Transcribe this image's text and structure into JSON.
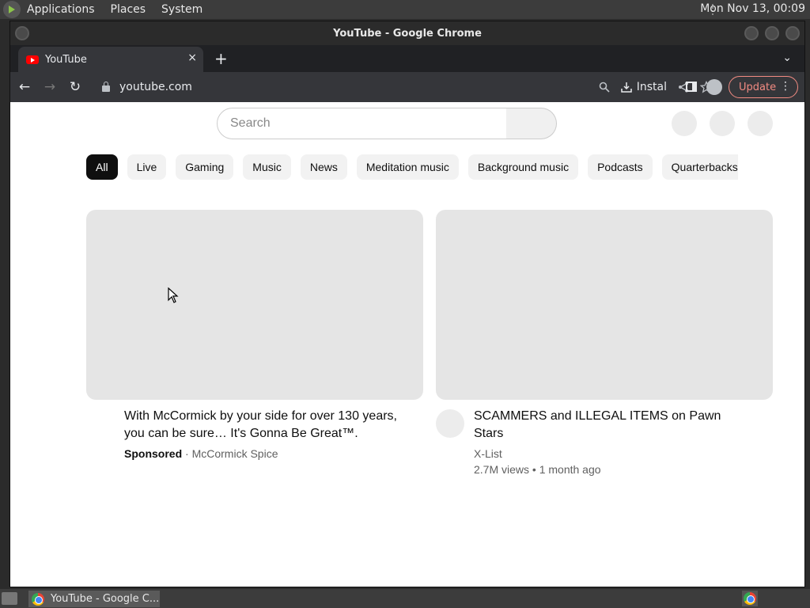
{
  "desktop": {
    "menus": [
      "Applications",
      "Places",
      "System"
    ],
    "clock": "Mon Nov 13, 00:09"
  },
  "window": {
    "title": "YouTube - Google Chrome"
  },
  "tab": {
    "title": "YouTube",
    "close": "×",
    "new_tab": "+",
    "tab_search": "⌄"
  },
  "toolbar": {
    "back": "←",
    "forward": "→",
    "reload": "↻",
    "url": "youtube.com",
    "install_label": "Instal",
    "update_label": "Update",
    "menu": "⋮"
  },
  "youtube": {
    "search_placeholder": "Search",
    "chips": [
      "All",
      "Live",
      "Gaming",
      "Music",
      "News",
      "Meditation music",
      "Background music",
      "Podcasts",
      "Quarterbacks"
    ],
    "videos": [
      {
        "title": "With McCormick by your side for over 130 years, you can be sure… It's Gonna Be Great™.",
        "sponsored": "Sponsored",
        "dot": "·",
        "channel": "McCormick Spice"
      },
      {
        "title": "SCAMMERS and ILLEGAL ITEMS on Pawn Stars",
        "channel": "X-List",
        "stats": "2.7M views • 1 month ago"
      }
    ]
  },
  "taskbar": {
    "window_label": "YouTube - Google C..."
  }
}
